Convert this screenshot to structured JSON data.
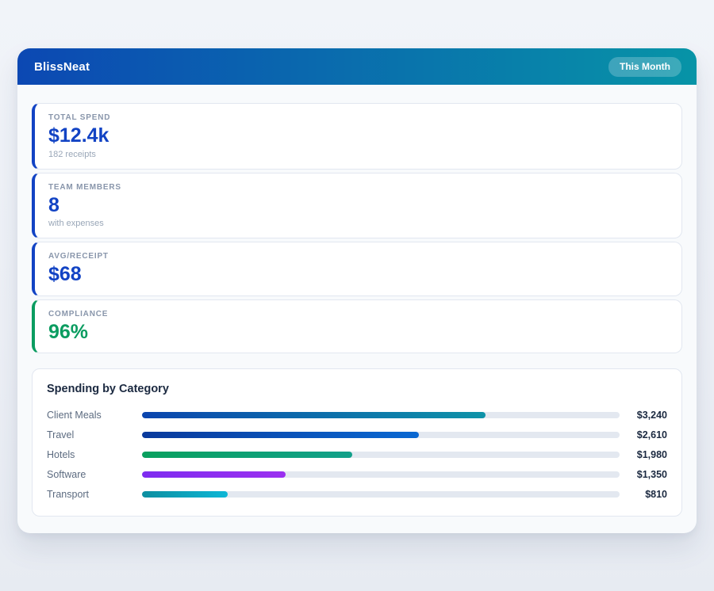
{
  "header": {
    "app_name": "BlissNeat",
    "period_badge": "This Month"
  },
  "colors": {
    "header_gradient": [
      "#0c48b3",
      "#0794a7"
    ],
    "badge_bg": "rgba(255,255,255,0.22)",
    "stat_accent_blue": "#1243c4",
    "stat_accent_green": "#0a9c60",
    "bar_track": "#e3e8f0"
  },
  "stats": [
    {
      "label": "TOTAL SPEND",
      "value": "$12.4k",
      "subtext": "182 receipts",
      "accent": "#1243c4"
    },
    {
      "label": "TEAM MEMBERS",
      "value": "8",
      "subtext": "with expenses",
      "accent": "#1243c4"
    },
    {
      "label": "AVG/RECEIPT",
      "value": "$68",
      "subtext": "",
      "accent": "#1243c4"
    },
    {
      "label": "COMPLIANCE",
      "value": "96%",
      "subtext": "",
      "accent": "#0a9c60"
    }
  ],
  "chart_data": {
    "type": "bar",
    "orientation": "horizontal",
    "title": "Spending by Category",
    "categories": [
      "Client Meals",
      "Travel",
      "Hotels",
      "Software",
      "Transport"
    ],
    "values": [
      3240,
      2610,
      1980,
      1350,
      810
    ],
    "value_labels": [
      "$3,240",
      "$2,610",
      "$1,980",
      "$1,350",
      "$810"
    ],
    "axis_max": 4500,
    "grid": false,
    "legend": false,
    "bar_gradients": [
      [
        "#0b45ae",
        "#0e93a8"
      ],
      [
        "#0a3a9c",
        "#0a68d2"
      ],
      [
        "#09a05e",
        "#12a08a"
      ],
      [
        "#7e2cf0",
        "#9b30f0"
      ],
      [
        "#0d8fa0",
        "#0db6d6"
      ]
    ]
  }
}
